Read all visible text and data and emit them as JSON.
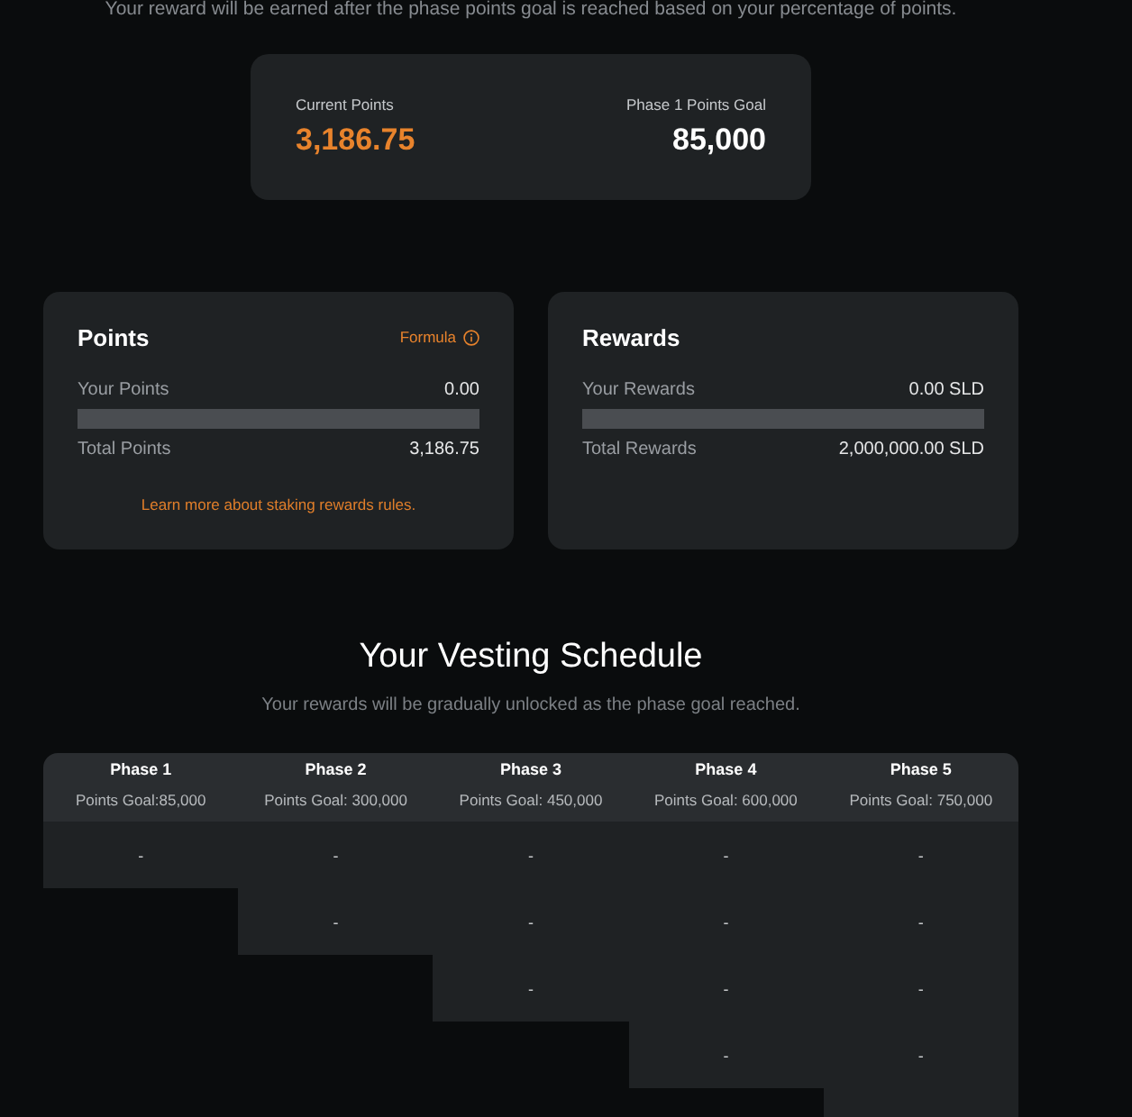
{
  "intro": "Your reward will be earned after the phase points goal is reached based on your percentage of points.",
  "summary": {
    "current_label": "Current Points",
    "current_value": "3,186.75",
    "goal_label": "Phase 1 Points Goal",
    "goal_value": "85,000"
  },
  "stat_cards": [
    {
      "title": "Points",
      "action": "Formula",
      "your_label": "Your Points",
      "your_value": "0.00",
      "total_label": "Total Points",
      "total_value": "3,186.75",
      "footer_link": "Learn more about staking rewards rules."
    },
    {
      "title": "Rewards",
      "your_label": "Your Rewards",
      "your_value": "0.00 SLD",
      "total_label": "Total Rewards",
      "total_value": "2,000,000.00 SLD"
    }
  ],
  "vesting": {
    "title": "Your Vesting Schedule",
    "subtitle": "Your rewards will be gradually unlocked as the phase goal reached.",
    "columns": [
      {
        "phase": "Phase 1",
        "goal": "Points Goal:85,000"
      },
      {
        "phase": "Phase 2",
        "goal": "Points Goal: 300,000"
      },
      {
        "phase": "Phase 3",
        "goal": "Points Goal: 450,000"
      },
      {
        "phase": "Phase 4",
        "goal": "Points Goal: 600,000"
      },
      {
        "phase": "Phase 5",
        "goal": "Points Goal: 750,000"
      }
    ],
    "rows": [
      {
        "cells": [
          {
            "kind": "value",
            "text": "-"
          },
          {
            "kind": "value",
            "text": "-"
          },
          {
            "kind": "value",
            "text": "-"
          },
          {
            "kind": "value",
            "text": "-"
          },
          {
            "kind": "value",
            "text": "-"
          }
        ]
      },
      {
        "cells": [
          {
            "kind": "blank"
          },
          {
            "kind": "value",
            "text": "-"
          },
          {
            "kind": "value",
            "text": "-"
          },
          {
            "kind": "value",
            "text": "-"
          },
          {
            "kind": "value",
            "text": "-"
          }
        ]
      },
      {
        "cells": [
          {
            "kind": "blank"
          },
          {
            "kind": "blank"
          },
          {
            "kind": "value",
            "text": "-"
          },
          {
            "kind": "value",
            "text": "-"
          },
          {
            "kind": "value",
            "text": "-"
          }
        ]
      },
      {
        "cells": [
          {
            "kind": "blank"
          },
          {
            "kind": "blank"
          },
          {
            "kind": "blank"
          },
          {
            "kind": "value",
            "text": "-"
          },
          {
            "kind": "value",
            "text": "-"
          }
        ]
      },
      {
        "cells": [
          {
            "kind": "blank"
          },
          {
            "kind": "blank"
          },
          {
            "kind": "blank"
          },
          {
            "kind": "blank"
          },
          {
            "kind": "value"
          }
        ]
      }
    ]
  }
}
